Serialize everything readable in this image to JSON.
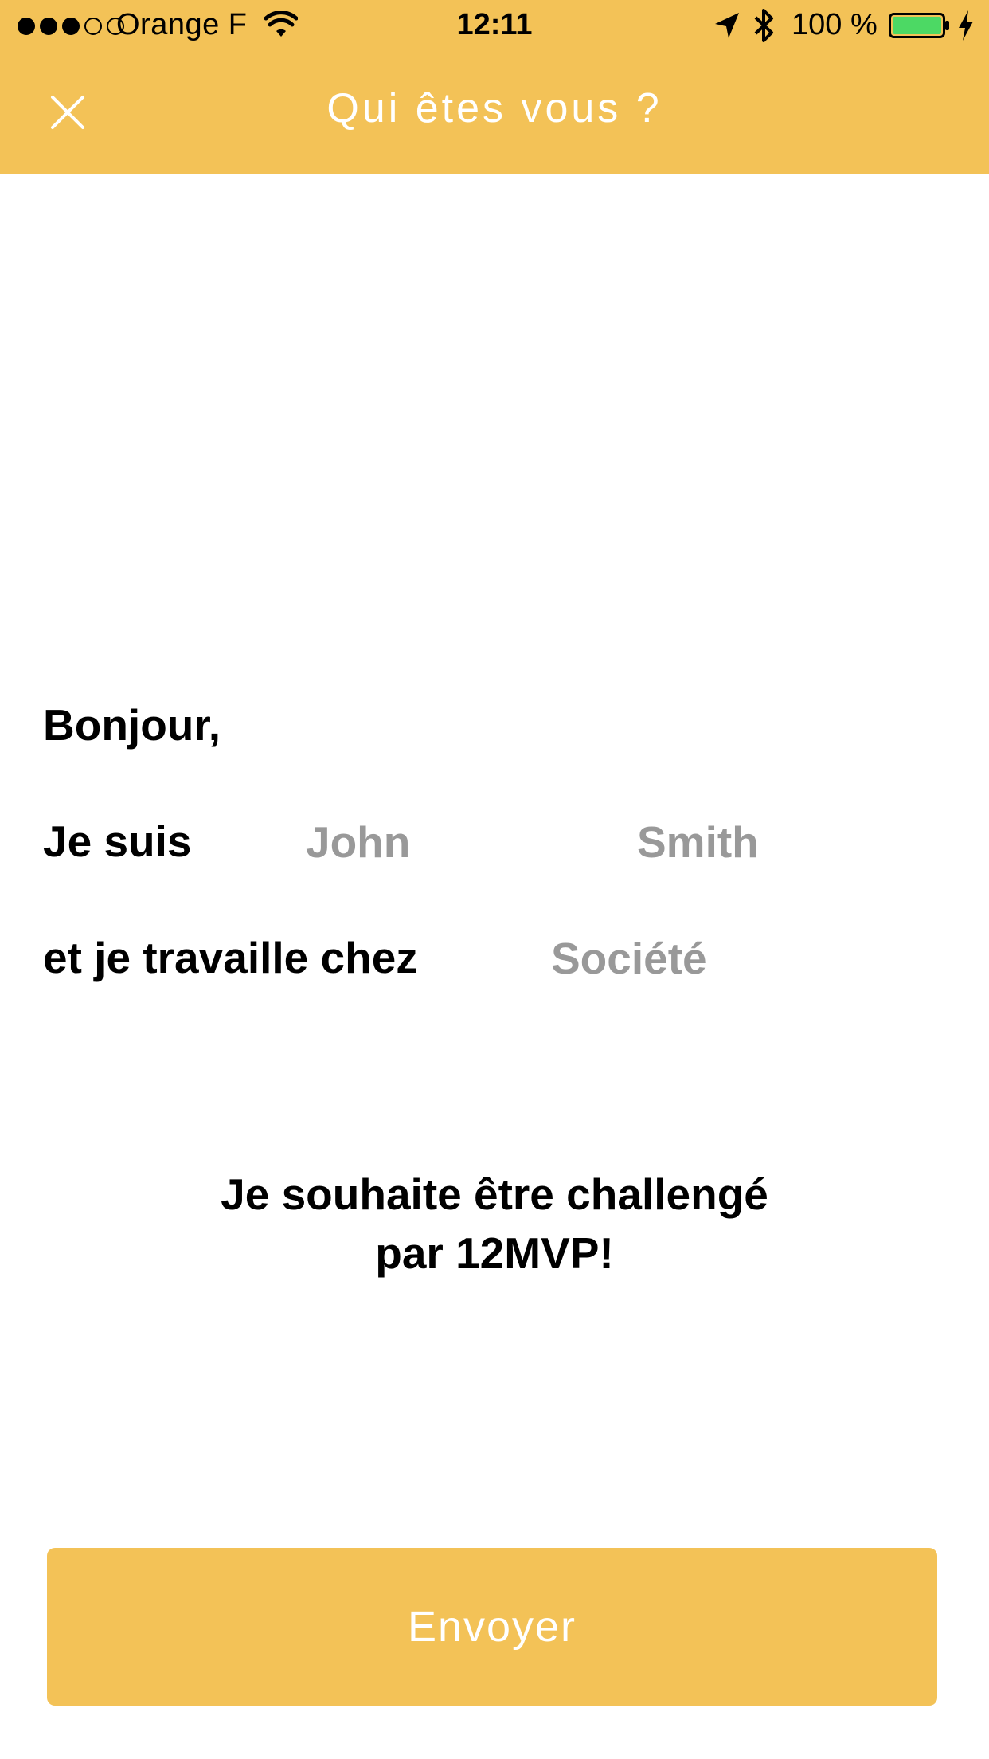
{
  "status_bar": {
    "carrier": "Orange F",
    "time": "12:11",
    "battery": "100 %",
    "signal_bars_filled": 3,
    "signal_bars_total": 5,
    "battery_level_fraction": 1.0,
    "icons": [
      "signal-dots",
      "wifi-icon",
      "location-arrow-icon",
      "bluetooth-icon",
      "battery-icon",
      "charging-bolt-icon"
    ]
  },
  "nav": {
    "title": "Qui êtes vous ?",
    "close_icon": "close-x-icon"
  },
  "form": {
    "greeting": "Bonjour,",
    "je_suis_label": "Je suis",
    "firstname_placeholder": "John",
    "lastname_placeholder": "Smith",
    "work_label": "et je travaille chez",
    "company_placeholder": "Société",
    "tagline_line1": "Je souhaite être challengé",
    "tagline_line2": "par 12MVP!"
  },
  "actions": {
    "send_label": "Envoyer"
  },
  "colors": {
    "accent": "#F3C257",
    "placeholder": "#999999",
    "text": "#000000",
    "battery_fill": "#4CD964"
  }
}
